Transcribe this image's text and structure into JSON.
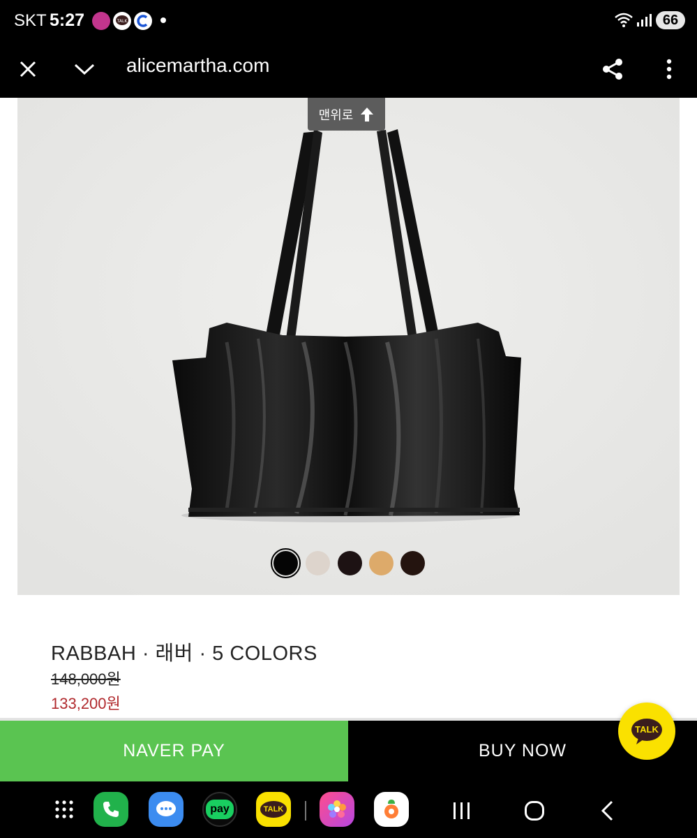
{
  "status_bar": {
    "carrier": "SKT",
    "time": "5:27",
    "battery": "66",
    "notifications": [
      "ponto-app-icon",
      "kakaotalk-icon",
      "coupang-icon"
    ]
  },
  "browser": {
    "url": "alicemartha.com",
    "close_icon": "close-icon",
    "minimize_icon": "chevron-down-icon",
    "share_icon": "share-icon",
    "menu_icon": "more-vertical-icon"
  },
  "page": {
    "scroll_top_label": "맨위로",
    "product_name": "RABBAH · 래버 · 5 COLORS",
    "price_original": "148,000원",
    "price_sale": "133,200원",
    "colors": [
      "#050505",
      "#ddd4cc",
      "#1d1213",
      "#ddaa6a",
      "#24140f"
    ],
    "selected_color_index": 0
  },
  "buy_bar": {
    "naver_pay_label": "NAVER PAY",
    "buy_now_label": "BUY NOW",
    "talk_label": "TALK",
    "naver_color": "#5ac451"
  },
  "nav_bar": {
    "apps": [
      "app-drawer-icon",
      "phone-icon",
      "messages-icon",
      "naver-pay-icon",
      "kakaotalk-icon",
      "gallery-icon",
      "carrot-market-icon"
    ],
    "pay_label": "pay",
    "talk_label": "TALK"
  }
}
